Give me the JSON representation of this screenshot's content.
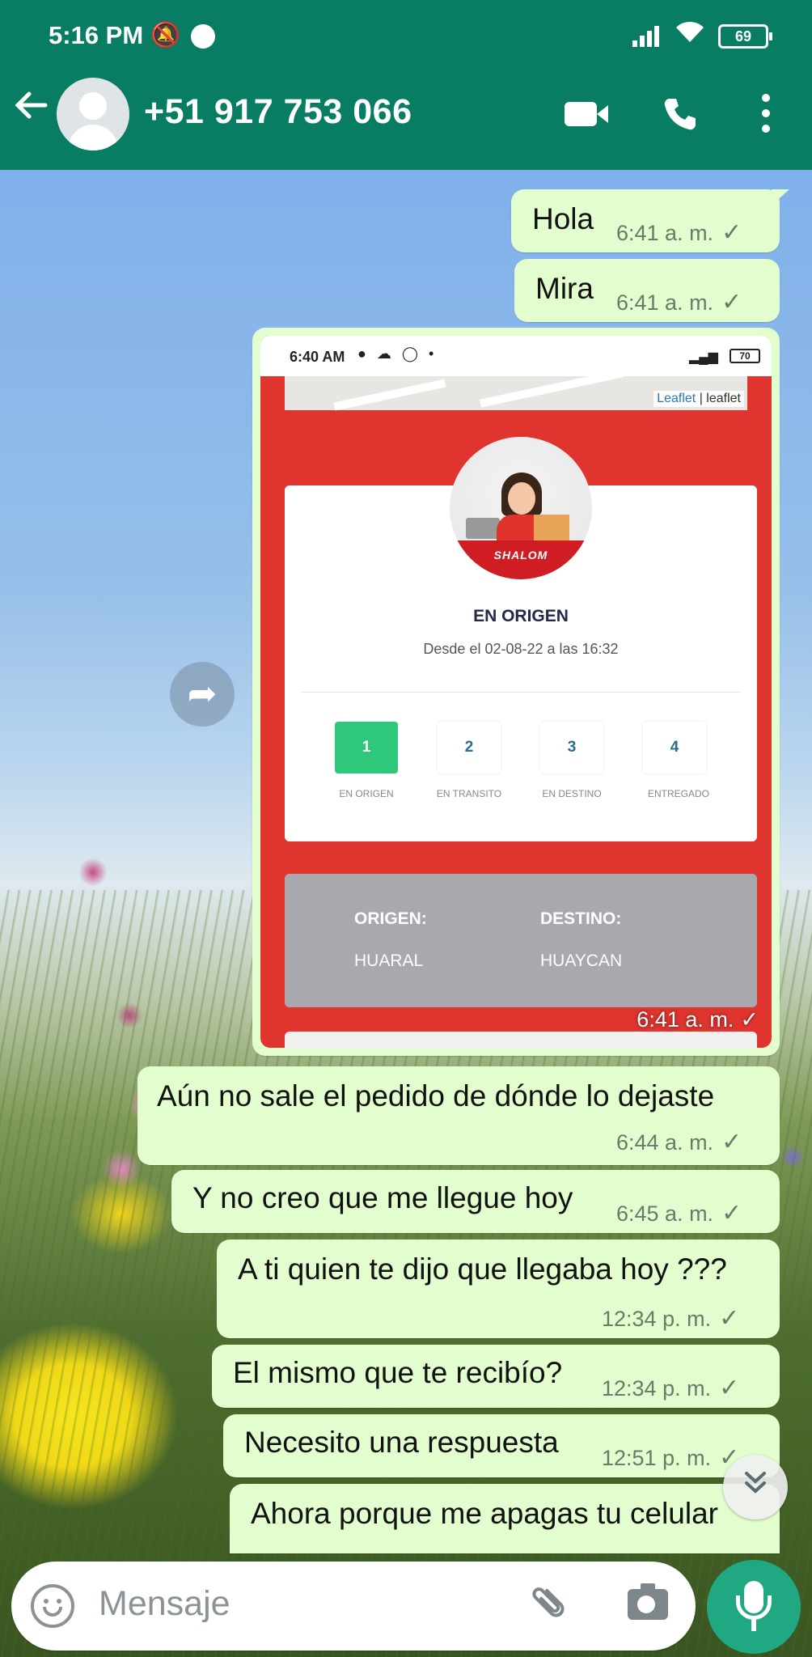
{
  "status_bar": {
    "time": "5:16 PM",
    "battery": "69",
    "icons": [
      "alarm-off-icon",
      "messenger-icon",
      "signal-icon",
      "wifi-icon",
      "battery-icon"
    ]
  },
  "header": {
    "contact_name": "+51 917 753 066",
    "icons": [
      "back-arrow-icon",
      "avatar-icon",
      "video-call-icon",
      "phone-icon",
      "more-vert-icon"
    ]
  },
  "messages": [
    {
      "text": "Hola",
      "time": "6:41 a. m."
    },
    {
      "text": "Mira",
      "time": "6:41 a. m."
    },
    {
      "type": "image",
      "time": "6:41 a. m."
    },
    {
      "text": "Aún no sale el pedido de dónde lo dejaste",
      "time": "6:44 a. m."
    },
    {
      "text": "Y no creo que me llegue hoy",
      "time": "6:45 a. m."
    },
    {
      "text": "A ti quien te dijo que llegaba hoy ???",
      "time": "12:34 p. m."
    },
    {
      "text": "El mismo que te recibío?",
      "time": "12:34 p. m."
    },
    {
      "text": "Necesito una respuesta",
      "time": "12:51 p. m."
    },
    {
      "text": "Ahora porque me apagas tu celular",
      "time": ""
    }
  ],
  "screenshot": {
    "time": "6:40 AM",
    "battery": "70",
    "map_attribution_link": "Leaflet",
    "map_attribution_sep": " | leaflet",
    "brand": "SHALOM",
    "status_title": "EN ORIGEN",
    "status_subtitle": "Desde el 02-08-22 a las 16:32",
    "steps": [
      {
        "number": "1",
        "label": "EN ORIGEN",
        "active": true
      },
      {
        "number": "2",
        "label": "EN TRANSITO",
        "active": false
      },
      {
        "number": "3",
        "label": "EN DESTINO",
        "active": false
      },
      {
        "number": "4",
        "label": "ENTREGADO",
        "active": false
      }
    ],
    "origin_label": "ORIGEN:",
    "origin_value": "HUARAL",
    "destination_label": "DESTINO:",
    "destination_value": "HUAYCAN"
  },
  "input": {
    "placeholder": "Mensaje"
  },
  "colors": {
    "header": "#087d63",
    "bubble": "#e2fdce",
    "mic_button": "#1fa881",
    "shalom_red": "#e0352f",
    "step_active": "#2fc77c"
  }
}
